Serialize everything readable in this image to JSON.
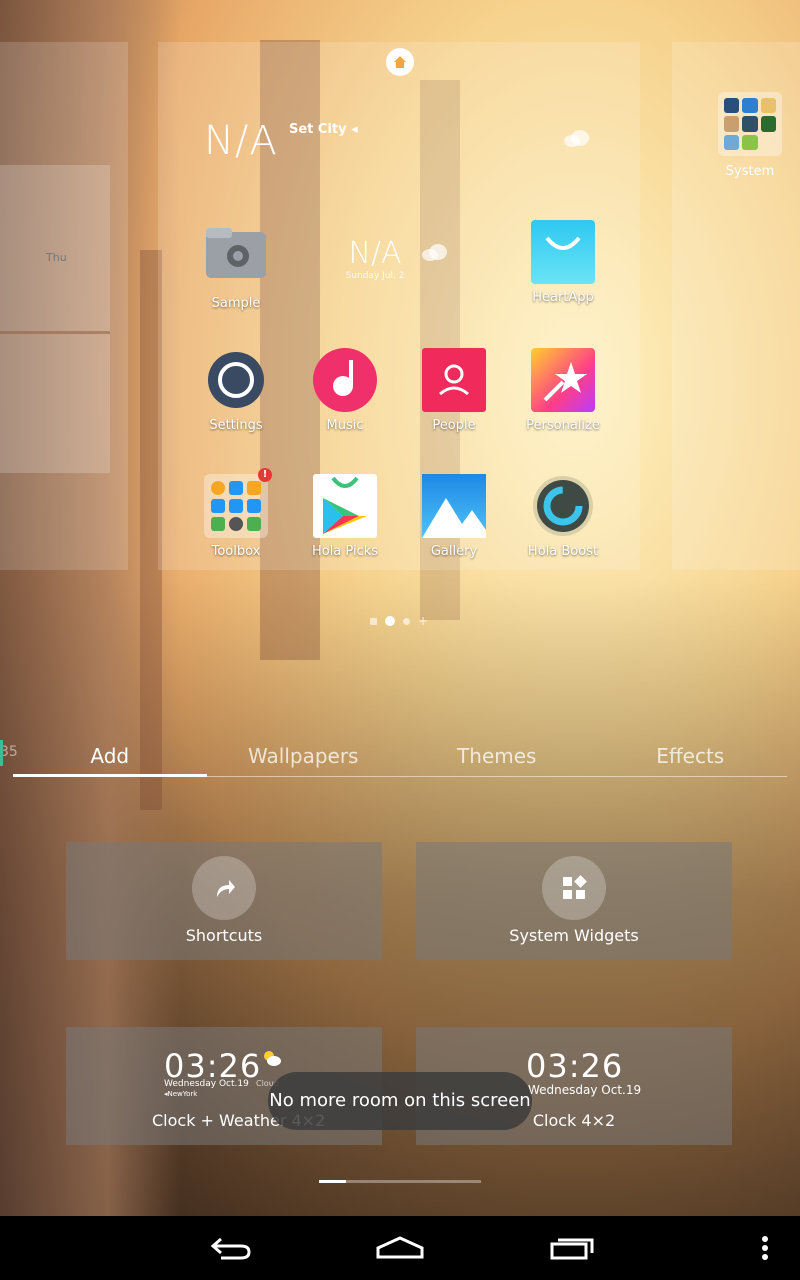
{
  "home": {
    "weather_temp": "N/A",
    "set_city": "Set City",
    "mini_weather_temp": "N/A",
    "mini_weather_date": "Sunday Jul. 2",
    "left_panel_day": "Thu"
  },
  "apps": [
    {
      "label": "Sample",
      "icon": "sample-folder-icon"
    },
    {
      "label": "HeartApp",
      "icon": "heartapp-icon"
    },
    {
      "label": "Settings",
      "icon": "settings-gear-icon"
    },
    {
      "label": "Music",
      "icon": "music-icon"
    },
    {
      "label": "People",
      "icon": "people-icon"
    },
    {
      "label": "Personalize",
      "icon": "personalize-icon"
    },
    {
      "label": "Toolbox",
      "icon": "toolbox-icon"
    },
    {
      "label": "Hola Picks",
      "icon": "hola-picks-icon"
    },
    {
      "label": "Gallery",
      "icon": "gallery-icon"
    },
    {
      "label": "Hola Boost",
      "icon": "hola-boost-icon"
    }
  ],
  "system_folder": {
    "label": "System"
  },
  "toolbox_badge": "!",
  "edge_number": "35",
  "tabs": [
    "Add",
    "Wallpapers",
    "Themes",
    "Effects"
  ],
  "tiles": {
    "shortcuts": "Shortcuts",
    "system_widgets": "System Widgets",
    "clock_weather": "Clock + Weather 4×2",
    "clock": "Clock 4×2",
    "clock_time": "03:26",
    "clock_date": "Wednesday Oct.19",
    "clock_location": "NewYork",
    "clock_cloud": "Cloud"
  },
  "toast": "No more room on this screen",
  "colors": {
    "accent": "#3dbb9a",
    "navbar": "#000000"
  }
}
